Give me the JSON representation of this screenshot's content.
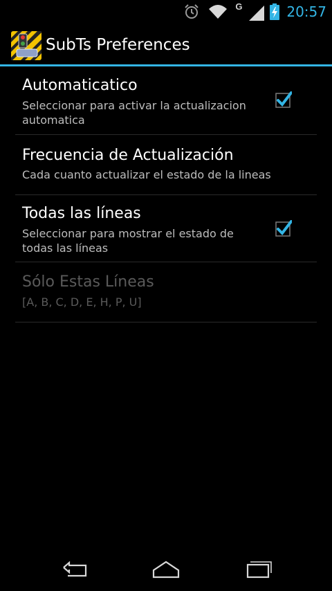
{
  "status_bar": {
    "time": "20:57",
    "network_type": "G",
    "icons": [
      "alarm-icon",
      "wifi-icon",
      "signal-icon",
      "battery-charging-icon"
    ]
  },
  "action_bar": {
    "title": "SubTs Preferences",
    "accent_color": "#33b5e5"
  },
  "preferences": [
    {
      "title": "Automaticatico",
      "summary": "Seleccionar para activar la actualizacion automatica",
      "checked": true
    },
    {
      "title": "Frecuencia de Actualización",
      "summary": "Cada cuanto actualizar el estado de la lineas"
    },
    {
      "title": "Todas las líneas",
      "summary": "Seleccionar para mostrar el estado de todas las líneas",
      "checked": true
    },
    {
      "title": "Sólo Estas Líneas",
      "summary": "[A, B, C, D, E, H, P, U]",
      "enabled": false
    }
  ],
  "nav_bar": {
    "icons": [
      "back-icon",
      "home-icon",
      "recent-apps-icon"
    ]
  }
}
